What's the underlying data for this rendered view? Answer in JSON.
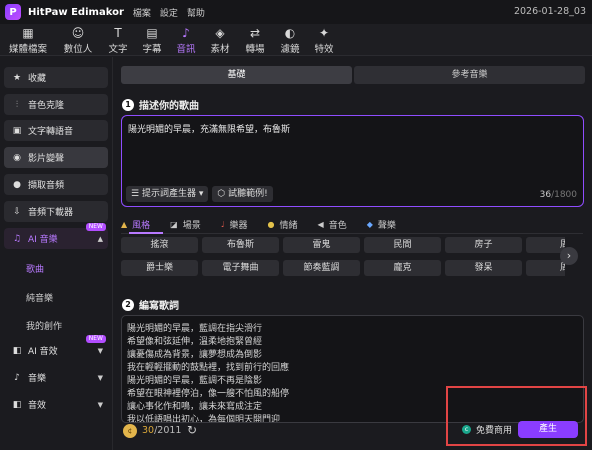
{
  "titlebar": {
    "app_name": "HitPaw Edimakor",
    "menus": [
      "檔案",
      "設定",
      "幫助"
    ],
    "project_name": "2026-01-28_03"
  },
  "toolbar": {
    "tools": [
      {
        "label": "媒體檔案",
        "icon": "media-icon"
      },
      {
        "label": "數位人",
        "icon": "avatar-icon"
      },
      {
        "label": "文字",
        "icon": "text-icon"
      },
      {
        "label": "字幕",
        "icon": "subtitle-icon"
      },
      {
        "label": "音訊",
        "icon": "music-note-icon"
      },
      {
        "label": "素材",
        "icon": "assets-icon"
      },
      {
        "label": "轉場",
        "icon": "transition-icon"
      },
      {
        "label": "濾鏡",
        "icon": "filter-icon"
      },
      {
        "label": "特效",
        "icon": "effects-icon"
      }
    ],
    "active_tool": "音訊"
  },
  "sidebar": {
    "items": [
      {
        "label": "收藏",
        "icon": "star-icon"
      },
      {
        "label": "音色克隆",
        "icon": "waveform-icon"
      },
      {
        "label": "文字轉語音",
        "icon": "text-to-speech-icon"
      },
      {
        "label": "影片變聲",
        "icon": "voice-change-icon"
      },
      {
        "label": "擷取音頻",
        "icon": "microphone-icon"
      },
      {
        "label": "音頻下載器",
        "icon": "download-icon"
      }
    ],
    "ai_music": {
      "label": "AI 音樂",
      "badge": "NEW",
      "subitems": [
        "歌曲",
        "純音樂",
        "我的創作"
      ],
      "active_sub": "歌曲"
    },
    "ai_sfx": {
      "label": "AI 音效",
      "badge": "NEW"
    },
    "music": {
      "label": "音樂"
    },
    "sfx": {
      "label": "音效"
    }
  },
  "main": {
    "tabs": [
      "基礎",
      "參考音樂"
    ],
    "section1": {
      "num": "1",
      "title": "描述你的歌曲"
    },
    "description": {
      "text": "陽光明媚的早晨，充滿無限希望，布魯斯",
      "count": "36",
      "max": "/1800",
      "prompt_btn": "提示詞產生器",
      "example_btn": "試聽範例!"
    },
    "categories": [
      {
        "label": "風格",
        "icon": "bell-icon"
      },
      {
        "label": "場景",
        "icon": "scene-icon"
      },
      {
        "label": "樂器",
        "icon": "guitar-icon"
      },
      {
        "label": "情緒",
        "icon": "emoji-icon"
      },
      {
        "label": "音色",
        "icon": "speaker-icon"
      },
      {
        "label": "聲樂",
        "icon": "gem-icon"
      }
    ],
    "styles_row1": [
      "搖滾",
      "布魯斯",
      "雷鬼",
      "民間",
      "房子",
      "周"
    ],
    "styles_row2": [
      "爵士樂",
      "電子舞曲",
      "節奏藍調",
      "龐克",
      "發呆",
      "周"
    ],
    "section2": {
      "num": "2",
      "title": "編寫歌詞"
    },
    "lyrics": [
      "陽光明媚的早晨，藍調在指尖滑行",
      "希望像和弦延伸，溫柔地抱緊曾經",
      "讓憂傷成為背景，讓夢想成為倒影",
      "我在輕輕擺動的鼓點裡，找到前行的回應",
      "陽光明媚的早晨，藍調不再是陰影",
      "希望在眼神裡停泊，像一艘不怕風的船停",
      "讓心事化作和鳴，讓未來寫成注定",
      "我以低語唱出初心，為每個明天開門迎"
    ],
    "lyrics_count": {
      "current": "30",
      "max": "/2011"
    },
    "free_use": "免費商用",
    "generate": "產生"
  },
  "colors": {
    "accent": "#8a3dff",
    "highlight_frame": "#e24545",
    "coin": "#e3b54b"
  }
}
